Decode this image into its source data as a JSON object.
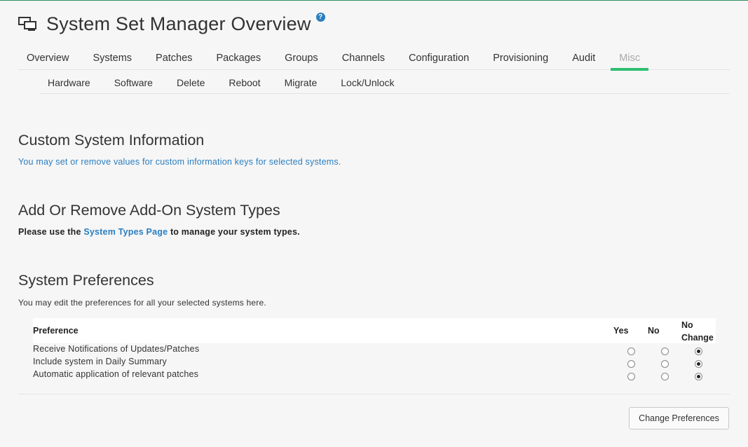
{
  "header": {
    "title": "System Set Manager Overview",
    "icon": "system-set-icon",
    "help": "?"
  },
  "tabs": [
    {
      "label": "Overview"
    },
    {
      "label": "Systems"
    },
    {
      "label": "Patches"
    },
    {
      "label": "Packages"
    },
    {
      "label": "Groups"
    },
    {
      "label": "Channels"
    },
    {
      "label": "Configuration"
    },
    {
      "label": "Provisioning"
    },
    {
      "label": "Audit"
    },
    {
      "label": "Misc",
      "active": true
    }
  ],
  "subtabs": [
    {
      "label": "Hardware"
    },
    {
      "label": "Software"
    },
    {
      "label": "Delete"
    },
    {
      "label": "Reboot"
    },
    {
      "label": "Migrate"
    },
    {
      "label": "Lock/Unlock"
    }
  ],
  "custom_info": {
    "title": "Custom System Information",
    "text": "You may set or remove values for custom information keys for selected systems."
  },
  "addon": {
    "title": "Add Or Remove Add-On System Types",
    "text_before": "Please use the",
    "link": "System Types Page",
    "text_after": "to manage your system types."
  },
  "prefs": {
    "title": "System Preferences",
    "text": "You may edit the preferences for all your selected systems here.",
    "headers": {
      "preference": "Preference",
      "yes": "Yes",
      "no": "No",
      "no_change_1": "No",
      "no_change_2": "Change"
    },
    "rows": [
      {
        "label": "Receive Notifications of Updates/Patches",
        "selected": "no_change"
      },
      {
        "label": "Include system in Daily Summary",
        "selected": "no_change"
      },
      {
        "label": "Automatic application of relevant patches",
        "selected": "no_change"
      }
    ],
    "button": "Change Preferences"
  },
  "colors": {
    "accent": "#2fbf71",
    "link": "#2a7ec0",
    "background": "#f6f6f6"
  }
}
